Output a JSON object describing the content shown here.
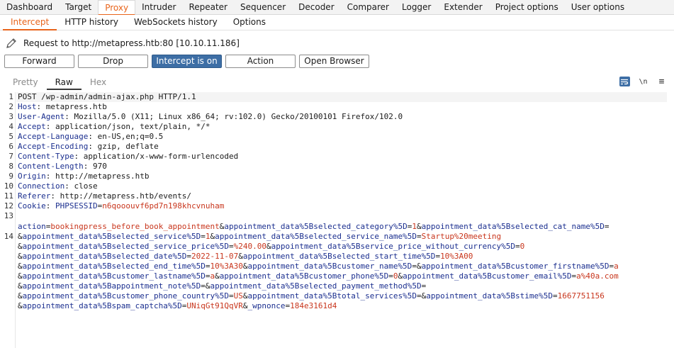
{
  "top_tabs": [
    {
      "label": "Dashboard"
    },
    {
      "label": "Target"
    },
    {
      "label": "Proxy"
    },
    {
      "label": "Intruder"
    },
    {
      "label": "Repeater"
    },
    {
      "label": "Sequencer"
    },
    {
      "label": "Decoder"
    },
    {
      "label": "Comparer"
    },
    {
      "label": "Logger"
    },
    {
      "label": "Extender"
    },
    {
      "label": "Project options"
    },
    {
      "label": "User options"
    }
  ],
  "sub_tabs": [
    {
      "label": "Intercept"
    },
    {
      "label": "HTTP history"
    },
    {
      "label": "WebSockets history"
    },
    {
      "label": "Options"
    }
  ],
  "request_info": "Request to http://metapress.htb:80  [10.10.11.186]",
  "buttons": {
    "forward": "Forward",
    "drop": "Drop",
    "intercept": "Intercept is on",
    "action": "Action",
    "open_browser": "Open Browser"
  },
  "view_tabs": [
    {
      "label": "Pretty"
    },
    {
      "label": "Raw"
    },
    {
      "label": "Hex"
    }
  ],
  "view_icons": {
    "newline_label": "\\n",
    "menu_label": "≡"
  },
  "request_lines": [
    {
      "n": "1",
      "text": "POST /wp-admin/admin-ajax.php HTTP/1.1"
    },
    {
      "n": "2",
      "key": "Host",
      "value": "metapress.htb"
    },
    {
      "n": "3",
      "key": "User-Agent",
      "value": "Mozilla/5.0 (X11; Linux x86_64; rv:102.0) Gecko/20100101 Firefox/102.0"
    },
    {
      "n": "4",
      "key": "Accept",
      "value": "application/json, text/plain, */*"
    },
    {
      "n": "5",
      "key": "Accept-Language",
      "value": "en-US,en;q=0.5"
    },
    {
      "n": "6",
      "key": "Accept-Encoding",
      "value": "gzip, deflate"
    },
    {
      "n": "7",
      "key": "Content-Type",
      "value": "application/x-www-form-urlencoded"
    },
    {
      "n": "8",
      "key": "Content-Length",
      "value": "970"
    },
    {
      "n": "9",
      "key": "Origin",
      "value": "http://metapress.htb"
    },
    {
      "n": "10",
      "key": "Connection",
      "value": "close"
    },
    {
      "n": "11",
      "key": "Referer",
      "value": "http://metapress.htb/events/"
    },
    {
      "n": "12",
      "key": "Cookie",
      "cookie_name": "PHPSESSID",
      "cookie_value": "n6qooouvf6pd7n198khcvnuham"
    },
    {
      "n": "13",
      "text": ""
    }
  ],
  "body_line_number": "14",
  "body_rows": [
    [
      [
        "action",
        "bookingpress_before_book_appointment"
      ],
      [
        "appointment_data%5Bselected_category%5D",
        "1"
      ],
      [
        "appointment_data%5Bselected_cat_name%5D",
        ""
      ]
    ],
    [
      [
        "appointment_data%5Bselected_service%5D",
        "1"
      ],
      [
        "appointment_data%5Bselected_service_name%5D",
        "Startup%20meeting"
      ]
    ],
    [
      [
        "appointment_data%5Bselected_service_price%5D",
        "%240.00"
      ],
      [
        "appointment_data%5Bservice_price_without_currency%5D",
        "0"
      ]
    ],
    [
      [
        "appointment_data%5Bselected_date%5D",
        "2022-11-07"
      ],
      [
        "appointment_data%5Bselected_start_time%5D",
        "10%3A00"
      ]
    ],
    [
      [
        "appointment_data%5Bselected_end_time%5D",
        "10%3A30"
      ],
      [
        "appointment_data%5Bcustomer_name%5D",
        ""
      ],
      [
        "appointment_data%5Bcustomer_firstname%5D",
        "a"
      ]
    ],
    [
      [
        "appointment_data%5Bcustomer_lastname%5D",
        "a"
      ],
      [
        "appointment_data%5Bcustomer_phone%5D",
        "0"
      ],
      [
        "appointment_data%5Bcustomer_email%5D",
        "a%40a.com"
      ]
    ],
    [
      [
        "appointment_data%5Bappointment_note%5D",
        ""
      ],
      [
        "appointment_data%5Bselected_payment_method%5D",
        ""
      ]
    ],
    [
      [
        "appointment_data%5Bcustomer_phone_country%5D",
        "US"
      ],
      [
        "appointment_data%5Btotal_services%5D",
        ""
      ],
      [
        "appointment_data%5Bstime%5D",
        "1667751156"
      ]
    ],
    [
      [
        "appointment_data%5Bspam_captcha%5D",
        "UNiqGt91QqVR"
      ],
      [
        "_wpnonce",
        "184e3161d4"
      ]
    ]
  ],
  "colors": {
    "accent_orange": "#e8641b",
    "intercept_blue": "#3d6ea5",
    "param_key": "#1b2f8f",
    "param_value": "#c8361d"
  }
}
